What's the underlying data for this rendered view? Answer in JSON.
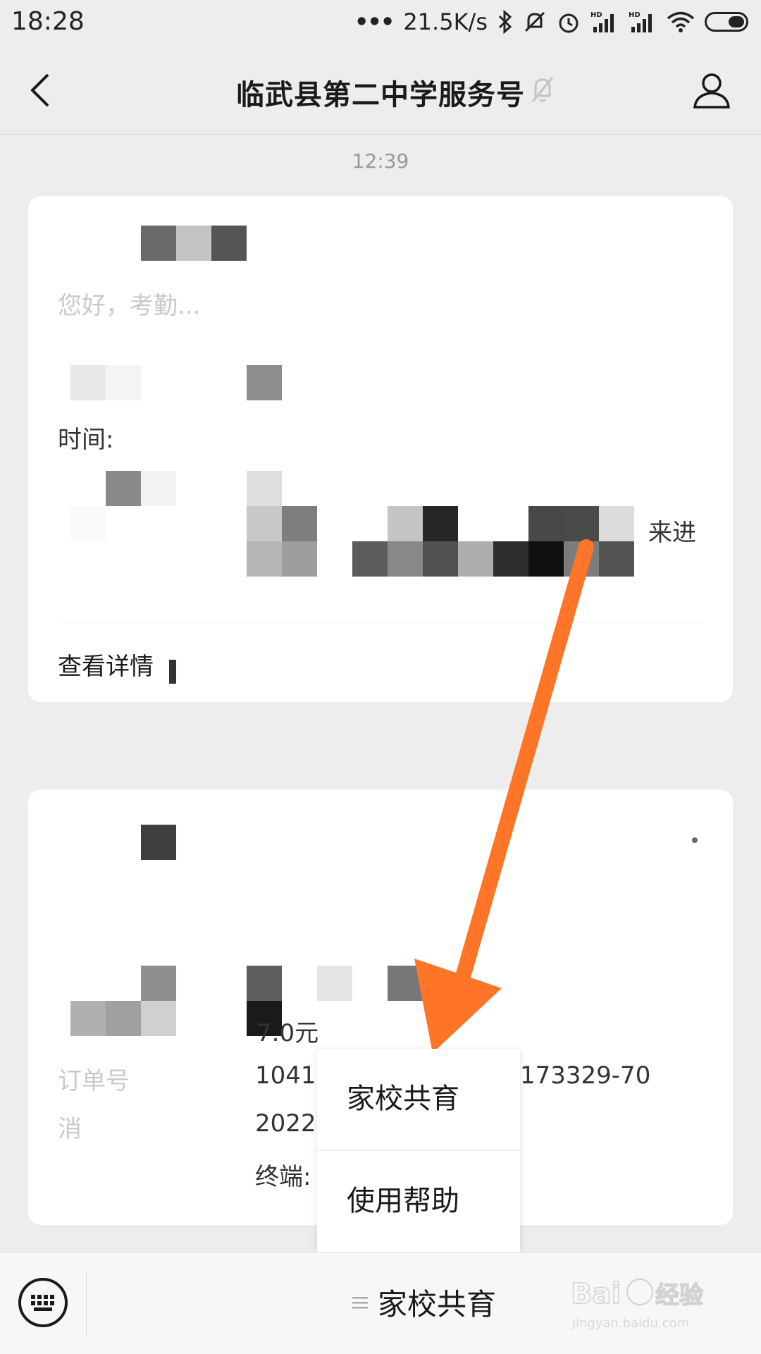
{
  "status_bar": {
    "time": "18:28",
    "net_speed": "21.5K/s",
    "icons": [
      "bluetooth-icon",
      "mute-icon",
      "alarm-icon",
      "signal-hd-icon",
      "signal-hd-icon",
      "wifi-icon",
      "battery-icon"
    ]
  },
  "header": {
    "title": "临武县第二中学服务号",
    "back_icon": "back-arrow-icon",
    "mute_icon": "muted-bell-icon",
    "profile_icon": "profile-icon"
  },
  "chat": {
    "timestamp": "12:39",
    "card1": {
      "time_label": "时间:",
      "text_right": "来进",
      "view_details": "查看详情"
    },
    "card2": {
      "amount": "7.0元",
      "order_label": "订单号",
      "order_prefix": "1041",
      "order_suffix": "173329-70",
      "date_prefix": "2022",
      "terminal_label": "终端:"
    }
  },
  "popup_menu": {
    "items": [
      {
        "label": "家校共育"
      },
      {
        "label": "使用帮助"
      }
    ]
  },
  "bottom_bar": {
    "keyboard_icon": "keyboard-icon",
    "menu_icon": "menu-lines-icon",
    "menu_label": "家校共育"
  },
  "watermark": {
    "text": "Baidu经验",
    "sub": "jingyan.baidu.com"
  },
  "colors": {
    "annotation_arrow": "#ff7528",
    "background": "#ededed"
  }
}
